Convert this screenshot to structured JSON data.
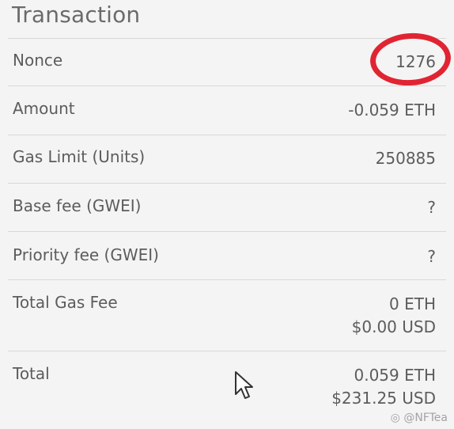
{
  "header": {
    "title": "Transaction"
  },
  "rows": [
    {
      "label": "Nonce",
      "value": "1276"
    },
    {
      "label": "Amount",
      "value": "-0.059 ETH"
    },
    {
      "label": "Gas Limit (Units)",
      "value": "250885"
    },
    {
      "label": "Base fee (GWEI)",
      "value": "?"
    },
    {
      "label": "Priority fee (GWEI)",
      "value": "?"
    },
    {
      "label": "Total Gas Fee",
      "value": "0 ETH",
      "value2": "$0.00 USD"
    },
    {
      "label": "Total",
      "value": "0.059 ETH",
      "value2": "$231.25 USD"
    }
  ],
  "annotation": {
    "color": "#e12432",
    "target": "Nonce"
  },
  "watermark": {
    "text": "@NFTea"
  }
}
